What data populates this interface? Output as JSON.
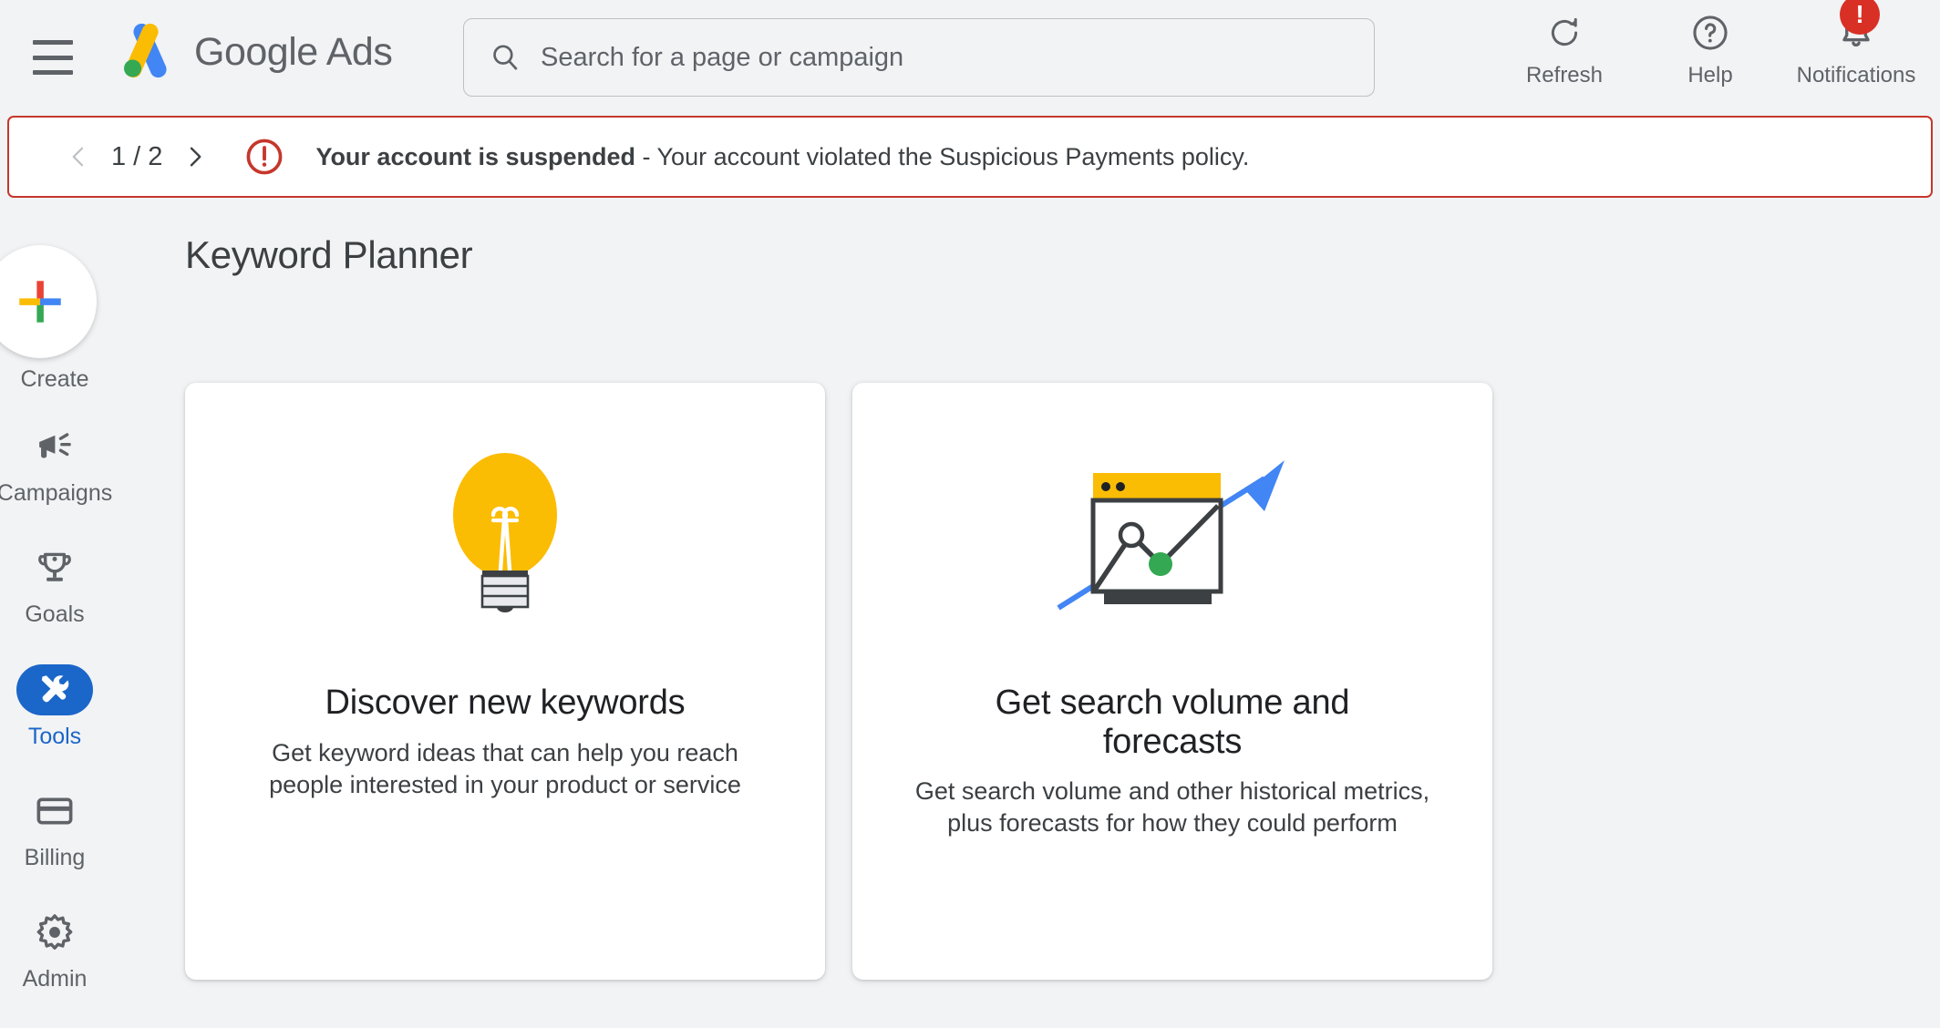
{
  "app": {
    "brand_google": "Google",
    "brand_ads": "Ads",
    "logo_icon": "google-ads-logo",
    "menu_icon": "hamburger-menu-icon"
  },
  "search": {
    "placeholder": "Search for a page or campaign",
    "value": "",
    "icon": "search-icon"
  },
  "top_actions": [
    {
      "label": "Refresh",
      "icon": "refresh-icon"
    },
    {
      "label": "Help",
      "icon": "help-circle-icon"
    },
    {
      "label": "Notifications",
      "icon": "bell-icon",
      "badge": "!"
    }
  ],
  "alert": {
    "prev_icon": "chevron-left-icon",
    "next_icon": "chevron-right-icon",
    "page_indicator": "1 / 2",
    "warning_icon": "error-exclamation-icon",
    "title": "Your account is suspended",
    "separator": " - ",
    "message": "Your account violated the Suspicious Payments policy.",
    "border_color": "#c5372c",
    "icon_color": "#c5372c"
  },
  "sidebar": {
    "create": {
      "label": "Create",
      "icon": "plus-icon"
    },
    "items": [
      {
        "label": "Campaigns",
        "icon": "megaphone-icon",
        "active": false
      },
      {
        "label": "Goals",
        "icon": "trophy-icon",
        "active": false
      },
      {
        "label": "Tools",
        "icon": "tools-wrench-icon",
        "active": true
      },
      {
        "label": "Billing",
        "icon": "credit-card-icon",
        "active": false
      },
      {
        "label": "Admin",
        "icon": "gear-icon",
        "active": false
      }
    ],
    "active_color": "#1b66c9"
  },
  "main": {
    "page_title": "Keyword Planner",
    "cards": [
      {
        "title": "Discover new keywords",
        "description": "Get keyword ideas that can help you reach people interested in your product or service",
        "art": "lightbulb-illustration",
        "art_colors": {
          "bulb": "#fbbc04",
          "base": "#e8eaed",
          "outline": "#3c4043"
        }
      },
      {
        "title": "Get search volume and forecasts",
        "description": "Get search volume and other historical metrics, plus forecasts for how they could perform",
        "art": "browser-chart-arrow-illustration",
        "art_colors": {
          "titlebar": "#fbbc04",
          "arrow": "#4285f4",
          "dot": "#34a853",
          "frame": "#3c4043"
        }
      }
    ]
  }
}
